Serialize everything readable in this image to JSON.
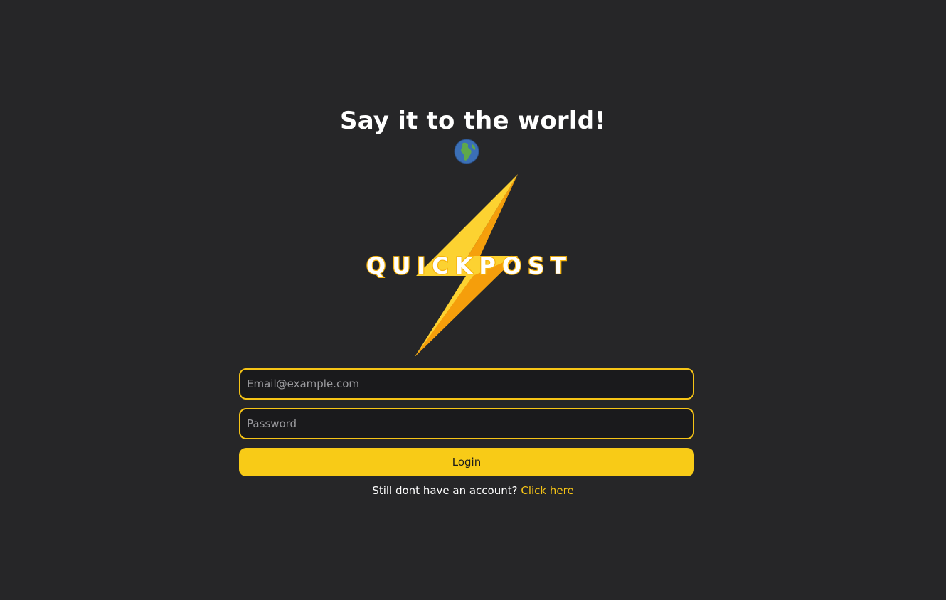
{
  "hero": {
    "headline": "Say it to the world!",
    "globe_icon": "globe-europe-africa-icon"
  },
  "brand": {
    "logo_text": "QUICKPOST",
    "logo_icon": "lightning-bolt-icon",
    "colors": {
      "bolt_light": "#fcd231",
      "bolt_dark": "#f59e0b",
      "text_fill": "#ffffff",
      "text_outline": "#f6b40e"
    }
  },
  "form": {
    "email_placeholder": "Email@example.com",
    "email_value": "",
    "password_placeholder": "Password",
    "password_value": "",
    "login_label": "Login"
  },
  "footer": {
    "prompt_text": "Still dont have an account?",
    "link_text": "Click here"
  },
  "theme": {
    "background": "#262628",
    "accent": "#f8cb17",
    "input_background": "#1a1a1c"
  }
}
